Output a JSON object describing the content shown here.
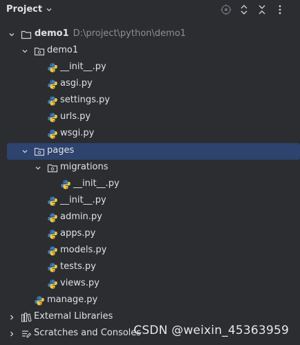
{
  "header": {
    "title": "Project",
    "icons": [
      "chevron-down-icon",
      "target-icon",
      "expand-all-icon",
      "collapse-all-icon",
      "more-vert-icon"
    ]
  },
  "tree": {
    "root": {
      "label": "demo1",
      "path": "D:\\project\\python\\demo1",
      "icon": "folder-icon"
    },
    "demo1_pkg": {
      "label": "demo1",
      "icon": "package-folder-icon"
    },
    "demo1_files": [
      "__init__.py",
      "asgi.py",
      "settings.py",
      "urls.py",
      "wsgi.py"
    ],
    "pages_pkg": {
      "label": "pages",
      "icon": "package-folder-icon"
    },
    "migrations_pkg": {
      "label": "migrations",
      "icon": "package-folder-icon"
    },
    "migrations_files": [
      "__init__.py"
    ],
    "pages_files": [
      "__init__.py",
      "admin.py",
      "apps.py",
      "models.py",
      "tests.py",
      "views.py"
    ],
    "manage": "manage.py",
    "external_libraries": "External Libraries",
    "scratches": "Scratches and Consoles"
  },
  "watermark": "CSDN @weixin_45363959",
  "colors": {
    "background": "#2b2d30",
    "selection": "#2e436e",
    "text": "#dfe1e5",
    "path_text": "#8c8f94",
    "python_blue": "#3d7ab8",
    "python_yellow": "#f2c83c"
  }
}
